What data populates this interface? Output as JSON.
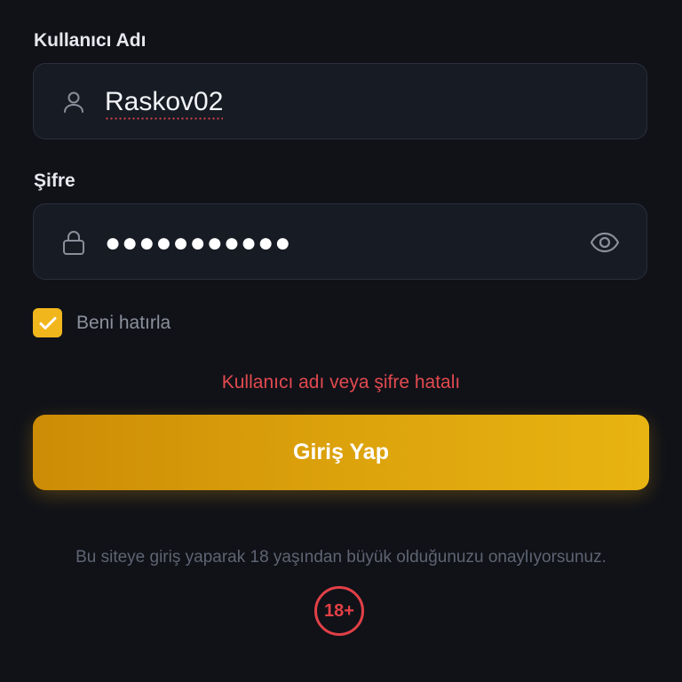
{
  "form": {
    "username_label": "Kullanıcı Adı",
    "username_value": "Raskov02",
    "password_label": "Şifre",
    "password_masked": "●●●●●●●●●●●",
    "remember_label": "Beni hatırla",
    "remember_checked": true,
    "error_message": "Kullanıcı adı veya şifre hatalı",
    "submit_label": "Giriş Yap"
  },
  "footer": {
    "disclaimer": "Bu siteye giriş yaparak 18 yaşından büyük olduğunuzu onaylıyorsunuz.",
    "age_badge": "18+"
  },
  "icons": {
    "username": "user-icon",
    "password": "lock-icon",
    "toggle_visibility": "eye-icon",
    "checkbox": "check-icon"
  },
  "colors": {
    "background": "#101218",
    "accent": "#f2b61d",
    "error": "#e24a4f"
  }
}
